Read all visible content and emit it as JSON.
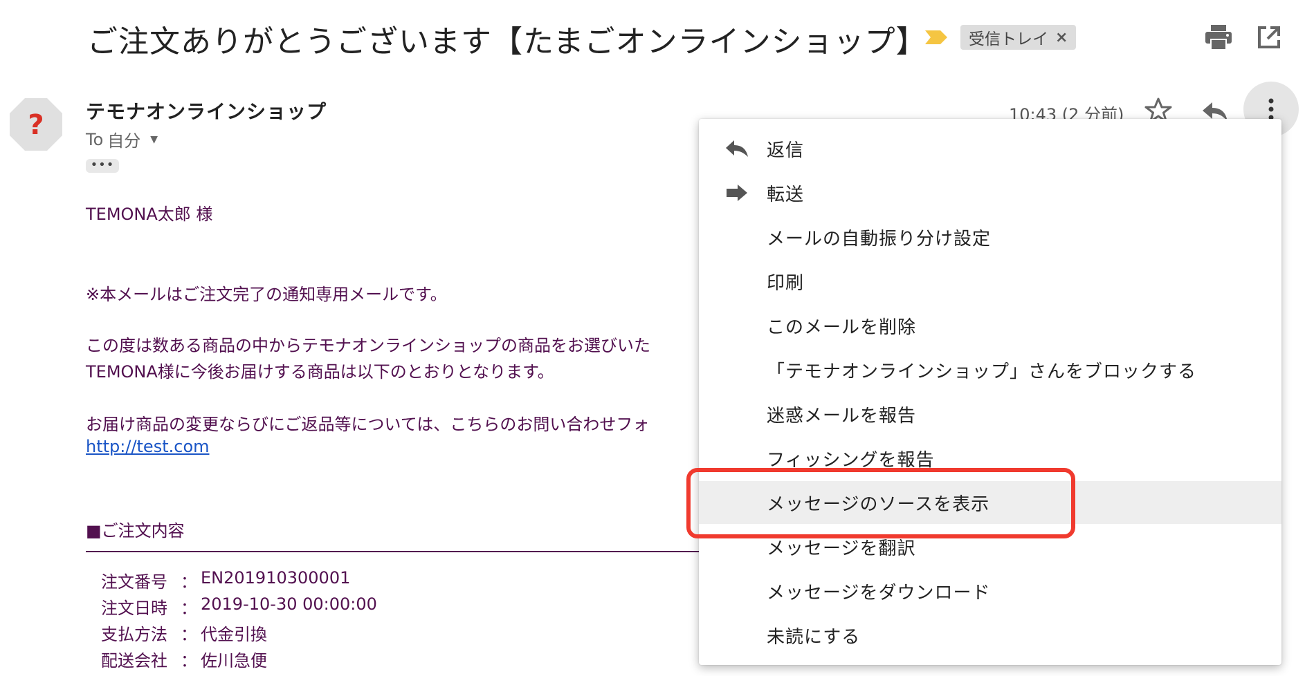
{
  "subject": "ご注文ありがとうございます【たまごオンラインショップ】",
  "label_chip": {
    "label": "受信トレイ",
    "remove": "×"
  },
  "sender": {
    "name": "テモナオンラインショップ",
    "to_prefix": "To",
    "to_name": "自分",
    "avatar_glyph": "?",
    "ellipsis": "•••",
    "time": "10:43 (2 分前)"
  },
  "body": {
    "greeting": "TEMONA太郎 様",
    "notice": "※本メールはご注文完了の通知専用メールです。",
    "para1_line1": "この度は数ある商品の中からテモナオンラインショップの商品をお選びいた",
    "para1_line2": "TEMONA様に今後お届けする商品は以下のとおりとなります。",
    "para2_line1": "お届け商品の変更ならびにご返品等については、こちらのお問い合わせフォ",
    "link": "http://test.com",
    "order_heading": "■ご注文内容",
    "order_rows": [
      {
        "key": "注文番号",
        "sep": "：",
        "value": "EN201910300001"
      },
      {
        "key": "注文日時",
        "sep": "：",
        "value": "2019-10-30 00:00:00"
      },
      {
        "key": "支払方法",
        "sep": "：",
        "value": "代金引換"
      },
      {
        "key": "配送会社",
        "sep": "：",
        "value": "佐川急便"
      }
    ]
  },
  "menu": {
    "items": [
      {
        "label": "返信",
        "icon": "reply-icon"
      },
      {
        "label": "転送",
        "icon": "forward-icon"
      },
      {
        "label": "メールの自動振り分け設定",
        "icon": ""
      },
      {
        "label": "印刷",
        "icon": ""
      },
      {
        "label": "このメールを削除",
        "icon": ""
      },
      {
        "label": "「テモナオンラインショップ」さんをブロックする",
        "icon": ""
      },
      {
        "label": "迷惑メールを報告",
        "icon": ""
      },
      {
        "label": "フィッシングを報告",
        "icon": ""
      },
      {
        "label": "メッセージのソースを表示",
        "icon": "",
        "highlighted": true
      },
      {
        "label": "メッセージを翻訳",
        "icon": ""
      },
      {
        "label": "メッセージをダウンロード",
        "icon": ""
      },
      {
        "label": "未読にする",
        "icon": ""
      }
    ]
  },
  "colors": {
    "body_text": "#52104f",
    "link": "#1a55c6",
    "highlight_border": "#f03a2e",
    "importance_marker": "#f5c542",
    "icon_gray": "#555555"
  },
  "icons": [
    "importance-marker-icon",
    "print-icon",
    "open-in-new-window-icon",
    "unknown-sender-icon",
    "dropdown-caret-icon",
    "star-icon",
    "reply-icon",
    "more-vert-icon",
    "forward-icon"
  ]
}
